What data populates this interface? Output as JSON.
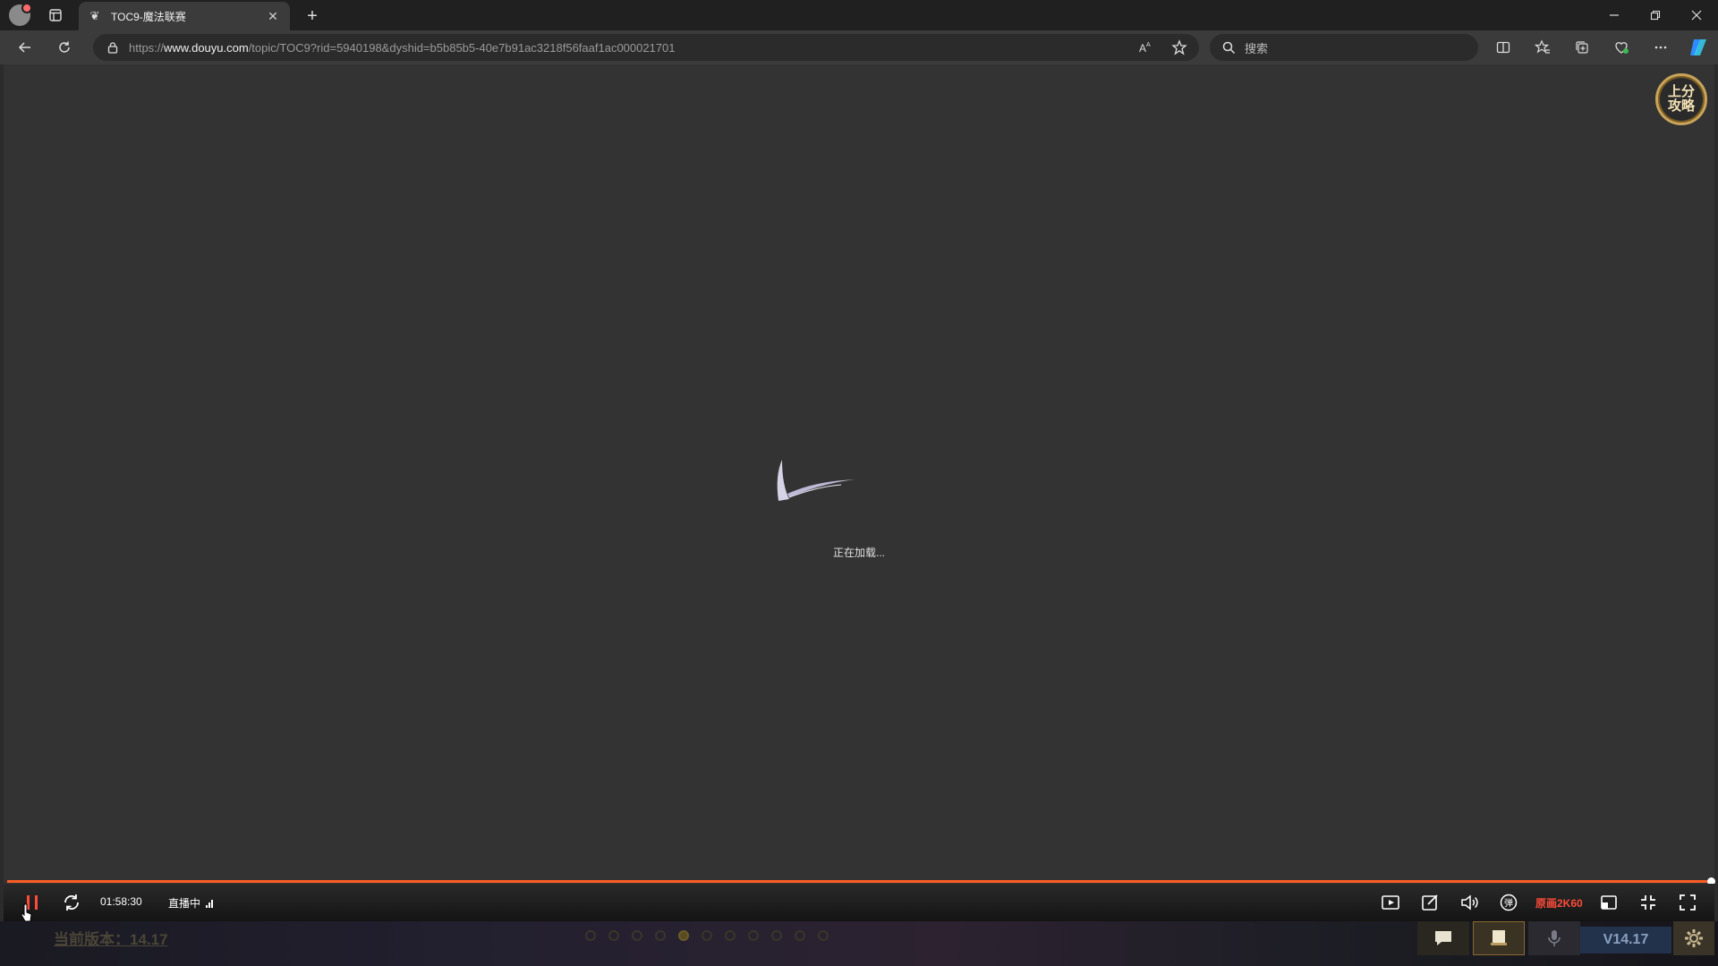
{
  "browser": {
    "tab_title": "TOC9-魔法联赛",
    "url_prefix": "https://",
    "url_domain": "www.douyu.com",
    "url_path": "/topic/TOC9?rid=5940198&dyshid=b5b85b5-40e7b91ac3218f56faaf1ac000021701",
    "search_placeholder": "搜索",
    "close_tab_glyph": "✕",
    "new_tab_glyph": "+",
    "tab_favicon_glyph": "❦"
  },
  "player": {
    "badge_text": "上分攻略",
    "loading_text": "正在加载...",
    "progress": 0.998,
    "time": "01:58:30",
    "live_label": "直播中",
    "quality_label": "原画2K60",
    "accent_color": "#ff5d23"
  },
  "bottom": {
    "version_left": "当前版本：14.17",
    "carousel_count": 11,
    "carousel_active": 4,
    "version_right": "V14.17"
  }
}
